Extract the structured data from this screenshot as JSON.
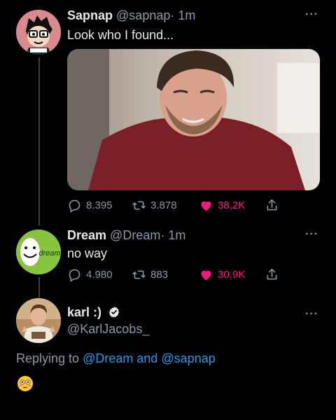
{
  "tweets": [
    {
      "name": "Sapnap",
      "handle": "@sapnap",
      "time": "· 1m",
      "text": "Look who I found...",
      "stats": {
        "replies": "8.395",
        "retweets": "3.878",
        "likes": "38,2K"
      }
    },
    {
      "name": "Dream",
      "handle": "@Dream",
      "time": "· 1m",
      "text": "no way",
      "avatar_text": "dream",
      "stats": {
        "replies": "4.980",
        "retweets": "883",
        "likes": "30,9K"
      }
    }
  ],
  "reply": {
    "name": "karl :)",
    "handle": "@KarlJacobs_",
    "replying_prefix": "Replying to",
    "replying_to": "@Dream and @sapnap",
    "emoji": "flushed-face"
  },
  "colors": {
    "background": "#000000",
    "text": "#e7e9ea",
    "secondary": "#8b98a5",
    "link": "#1d9bf0",
    "like": "#f91880",
    "dream_green": "#86c440"
  },
  "more_label": "···"
}
